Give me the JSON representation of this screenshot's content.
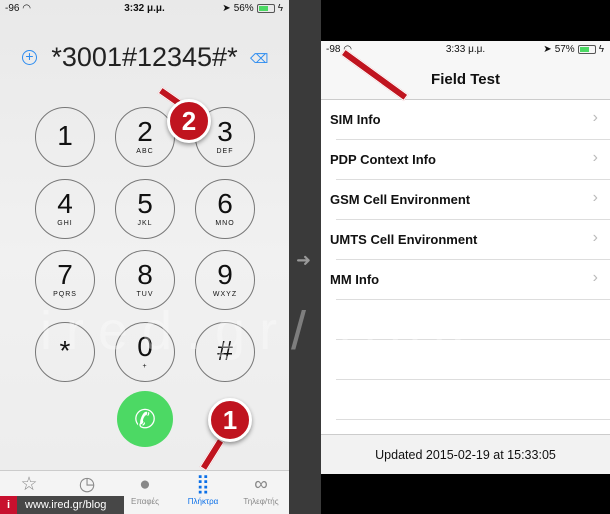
{
  "left_phone": {
    "status": {
      "signal": "-96",
      "time": "3:32 μ.μ.",
      "battery": "56%",
      "battery_level": 0.56
    },
    "dialed_number": "*3001#12345#*",
    "keys": [
      {
        "digit": "1",
        "letters": ""
      },
      {
        "digit": "2",
        "letters": "ABC"
      },
      {
        "digit": "3",
        "letters": "DEF"
      },
      {
        "digit": "4",
        "letters": "GHI"
      },
      {
        "digit": "5",
        "letters": "JKL"
      },
      {
        "digit": "6",
        "letters": "MNO"
      },
      {
        "digit": "7",
        "letters": "PQRS"
      },
      {
        "digit": "8",
        "letters": "TUV"
      },
      {
        "digit": "9",
        "letters": "WXYZ"
      },
      {
        "digit": "*",
        "letters": ""
      },
      {
        "digit": "0",
        "letters": "+"
      },
      {
        "digit": "#",
        "letters": ""
      }
    ],
    "tabs": [
      {
        "label": "",
        "icon": "star-icon"
      },
      {
        "label": "",
        "icon": "clock-icon"
      },
      {
        "label": "Επαφές",
        "icon": "contacts-icon"
      },
      {
        "label": "Πλήκτρα",
        "icon": "keypad-icon",
        "active": true
      },
      {
        "label": "Τηλεφ/τής",
        "icon": "voicemail-icon"
      }
    ],
    "accent": "#0a6fe8"
  },
  "right_phone": {
    "status": {
      "signal": "-98",
      "time": "3:33 μ.μ.",
      "battery": "57%",
      "battery_level": 0.57
    },
    "title": "Field Test",
    "items": [
      "SIM Info",
      "PDP Context Info",
      "GSM Cell Environment",
      "UMTS Cell Environment",
      "MM Info"
    ],
    "footer": "Updated 2015-02-19 at 15:33:05"
  },
  "annotations": {
    "marker1": "1",
    "marker2": "2",
    "marker_color": "#c0141f"
  },
  "watermark": {
    "text": "ired.gr/blog",
    "badge_letter": "i",
    "badge_text": "www.ired.gr/blog"
  }
}
